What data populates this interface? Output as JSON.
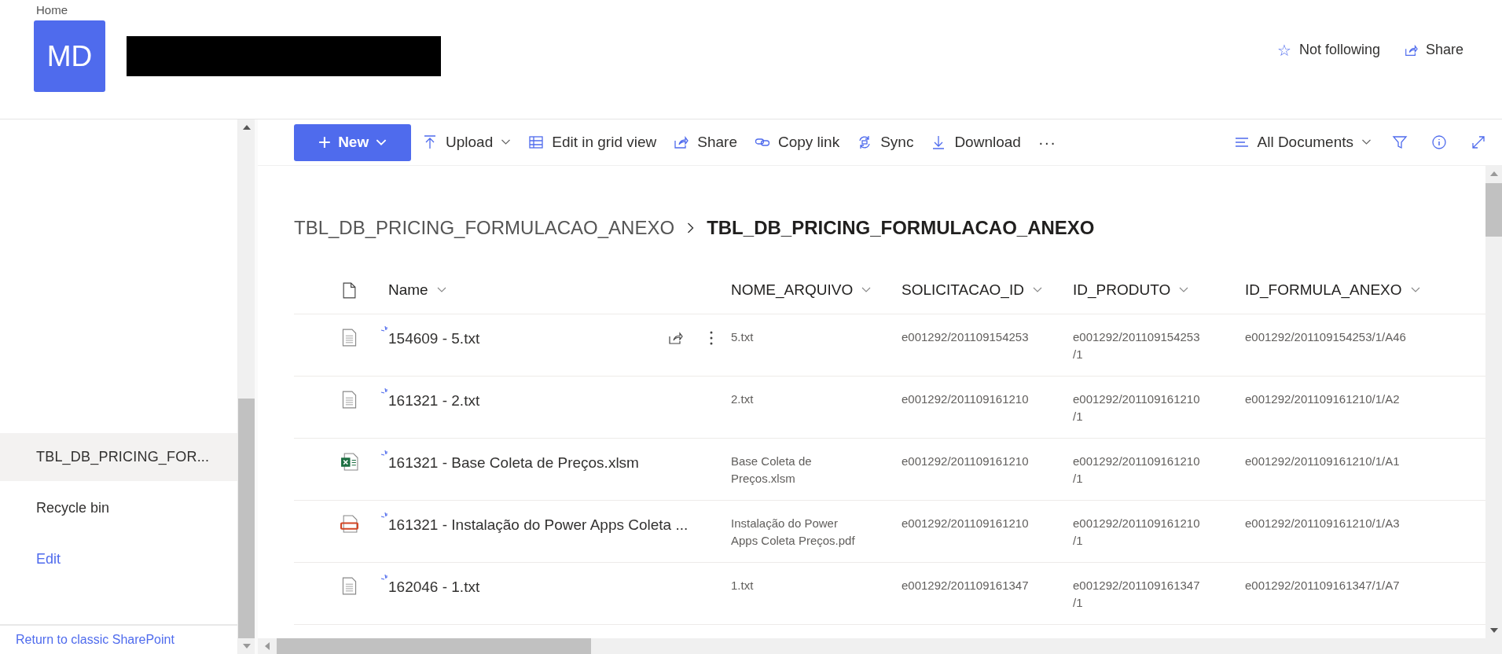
{
  "header": {
    "breadcrumb": "Home",
    "logo_initials": "MD",
    "follow": {
      "icon": "☆",
      "label": "Not following"
    },
    "share": "Share"
  },
  "sidebar": {
    "items": [
      {
        "label": "TBL_DB_PRICING_FOR...",
        "selected": true,
        "kind": "item"
      },
      {
        "label": "Recycle bin",
        "selected": false,
        "kind": "item"
      },
      {
        "label": "Edit",
        "selected": false,
        "kind": "link"
      }
    ],
    "footer_link": "Return to classic SharePoint"
  },
  "toolbar": {
    "new_button": {
      "icon": "+",
      "label": "New"
    },
    "commands": [
      {
        "kind": "upload",
        "label": "Upload",
        "has_menu": true
      },
      {
        "kind": "grid",
        "label": "Edit in grid view",
        "has_menu": false
      },
      {
        "kind": "share",
        "label": "Share",
        "has_menu": false
      },
      {
        "kind": "link",
        "label": "Copy link",
        "has_menu": false
      },
      {
        "kind": "sync",
        "label": "Sync",
        "has_menu": false
      },
      {
        "kind": "download",
        "label": "Download",
        "has_menu": false
      }
    ],
    "more": "···",
    "view": "All Documents"
  },
  "breadcrumb": [
    "TBL_DB_PRICING_FORMULACAO_ANEXO",
    "TBL_DB_PRICING_FORMULACAO_ANEXO"
  ],
  "table": {
    "columns": [
      "Name",
      "NOME_ARQUIVO",
      "SOLICITACAO_ID",
      "ID_PRODUTO",
      "ID_FORMULA_ANEXO"
    ],
    "rows": [
      {
        "kind": "txt",
        "actions_visible": true,
        "cells": [
          "154609 - 5.txt",
          "5.txt",
          "e001292/201109154253",
          "e001292/201109154253 /1",
          "e001292/201109154253/1/A46"
        ]
      },
      {
        "kind": "txt",
        "actions_visible": false,
        "cells": [
          "161321 - 2.txt",
          "2.txt",
          "e001292/201109161210",
          "e001292/201109161210 /1",
          "e001292/201109161210/1/A2"
        ]
      },
      {
        "kind": "excel",
        "actions_visible": false,
        "cells": [
          "161321 - Base Coleta de Preços.xlsm",
          "Base Coleta de Preços.xlsm",
          "e001292/201109161210",
          "e001292/201109161210 /1",
          "e001292/201109161210/1/A1"
        ]
      },
      {
        "kind": "pdf",
        "actions_visible": false,
        "cells": [
          "161321 - Instalação do Power Apps Coleta ...",
          "Instalação do Power Apps Coleta Preços.pdf",
          "e001292/201109161210",
          "e001292/201109161210 /1",
          "e001292/201109161210/1/A3"
        ]
      },
      {
        "kind": "txt",
        "actions_visible": false,
        "cells": [
          "162046 - 1.txt",
          "1.txt",
          "e001292/201109161347",
          "e001292/201109161347 /1",
          "e001292/201109161347/1/A7"
        ]
      }
    ]
  }
}
